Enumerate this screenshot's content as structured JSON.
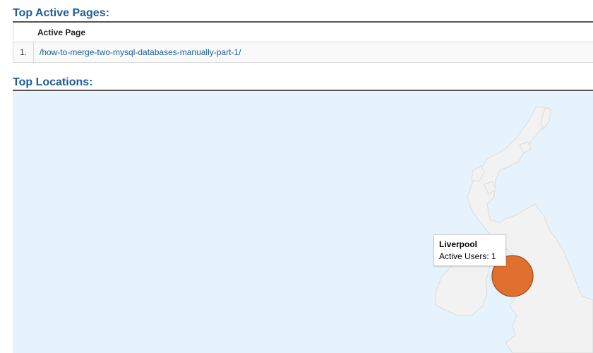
{
  "top_pages": {
    "title": "Top Active Pages:",
    "column_header": "Active Page",
    "rows": [
      {
        "index": "1.",
        "path": "/how-to-merge-two-mysql-databases-manually-part-1/"
      }
    ]
  },
  "top_locations": {
    "title": "Top Locations:",
    "tooltip": {
      "city": "Liverpool",
      "metric": "Active Users: 1"
    }
  },
  "colors": {
    "title": "#1f5d97",
    "link": "#1a5e9a",
    "map_water": "#e6f3fc",
    "map_land": "#f2f2f2",
    "marker": "#e07030"
  }
}
